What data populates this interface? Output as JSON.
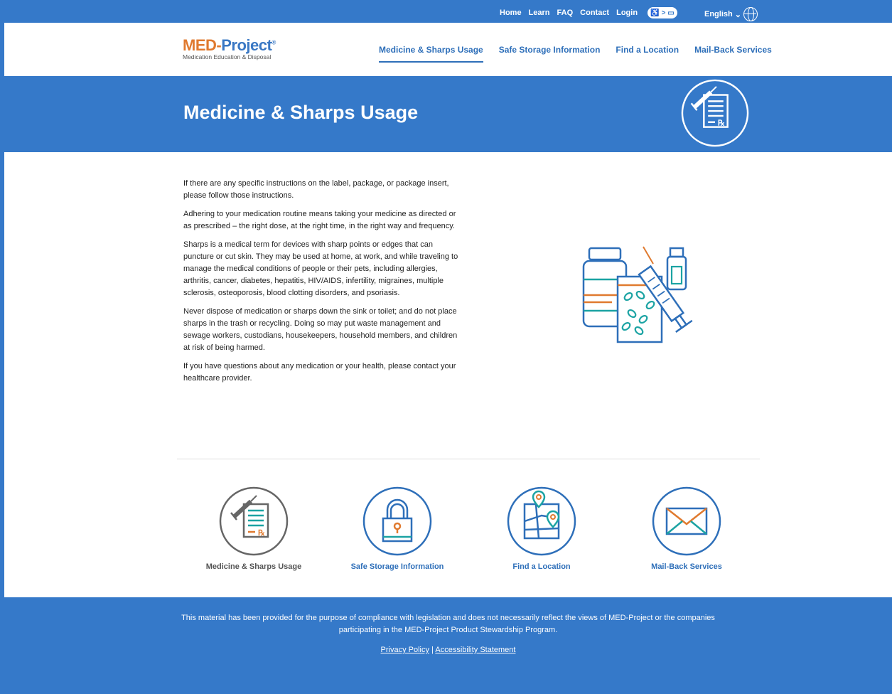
{
  "topbar": {
    "links": [
      "Home",
      "Learn",
      "FAQ",
      "Contact",
      "Login"
    ],
    "accessibility_toggle": "♿ > ▭",
    "language": "English",
    "language_chevron": "⌄"
  },
  "header": {
    "logo_med": "MED",
    "logo_dash": "-",
    "logo_project": "Project",
    "logo_reg": "®",
    "logo_subtitle": "Medication Education & Disposal",
    "nav": [
      "Medicine & Sharps Usage",
      "Safe Storage Information",
      "Find a Location",
      "Mail-Back Services"
    ]
  },
  "hero": {
    "title": "Medicine & Sharps Usage",
    "icon": "prescription-syringe-icon"
  },
  "content": {
    "paragraphs": [
      "If there are any specific instructions on the label, package, or package insert, please follow those instructions.",
      "Adhering to your medication routine means taking your medicine as directed or as prescribed – the right dose, at the right time, in the right way and frequency.",
      "Sharps is a medical term for devices with sharp points or edges that can puncture or cut skin. They may be used at home, at work, and while traveling to manage the medical conditions of people or their pets, including allergies, arthritis, cancer, diabetes, hepatitis, HIV/AIDS, infertility, migraines, multiple sclerosis, osteoporosis, blood clotting disorders, and psoriasis.",
      "Never dispose of medication or sharps down the sink or toilet; and do not place sharps in the trash or recycling. Doing so may put waste management and sewage workers, custodians, housekeepers, household members, and children at risk of being harmed.",
      "If you have questions about any medication or your health, please contact your healthcare provider."
    ],
    "illustration": "medication-bottles-syringe-illustration"
  },
  "cards": [
    {
      "label": "Medicine & Sharps Usage",
      "icon": "prescription-syringe-icon"
    },
    {
      "label": "Safe Storage Information",
      "icon": "padlock-icon"
    },
    {
      "label": "Find a Location",
      "icon": "map-pin-icon"
    },
    {
      "label": "Mail-Back Services",
      "icon": "envelope-icon"
    }
  ],
  "footer": {
    "text": "This material has been provided for the purpose of compliance with legislation and does not necessarily reflect the views of MED-Project or the companies participating in the MED-Project Product Stewardship Program.",
    "privacy": "Privacy Policy",
    "separator": "|",
    "accessibility": "Accessibility Statement"
  },
  "colors": {
    "brand_blue": "#3579c9",
    "brand_orange": "#e07a2f",
    "teal": "#1ba3a3"
  }
}
